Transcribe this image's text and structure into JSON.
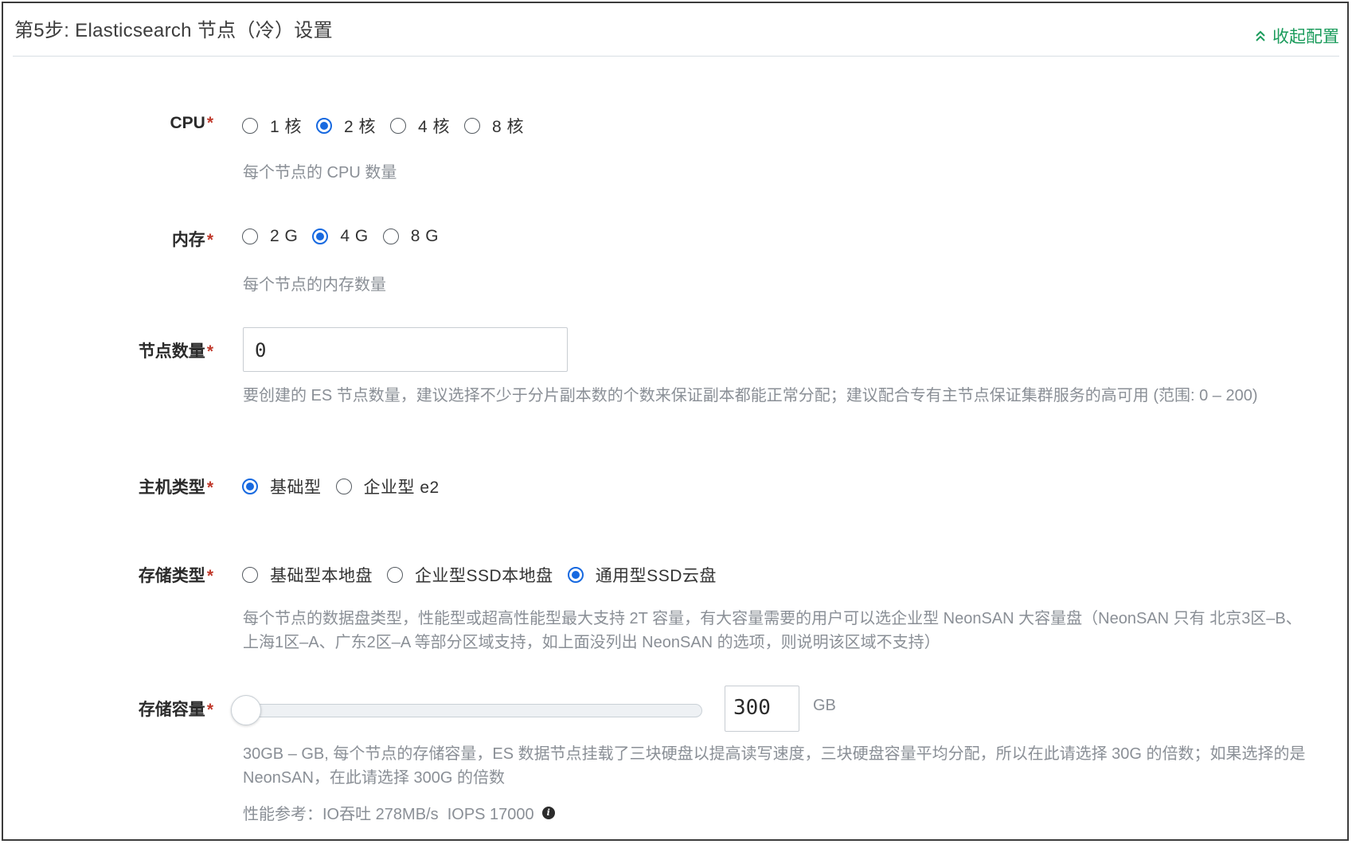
{
  "header": {
    "title": "第5步: Elasticsearch 节点（冷）设置",
    "collapse_label": "收起配置"
  },
  "cpu": {
    "label": "CPU",
    "required_mark": "*",
    "options": [
      {
        "label": "1 核",
        "selected": false
      },
      {
        "label": "2 核",
        "selected": true
      },
      {
        "label": "4 核",
        "selected": false
      },
      {
        "label": "8 核",
        "selected": false
      }
    ],
    "help": "每个节点的 CPU 数量"
  },
  "memory": {
    "label": "内存",
    "required_mark": "*",
    "options": [
      {
        "label": "2 G",
        "selected": false
      },
      {
        "label": "4 G",
        "selected": true
      },
      {
        "label": "8 G",
        "selected": false
      }
    ],
    "help": "每个节点的内存数量"
  },
  "node_count": {
    "label": "节点数量",
    "required_mark": "*",
    "value": "0",
    "help": "要创建的 ES 节点数量，建议选择不少于分片副本数的个数来保证副本都能正常分配；建议配合专有主节点保证集群服务的高可用 (范围: 0 – 200)"
  },
  "host_type": {
    "label": "主机类型",
    "required_mark": "*",
    "options": [
      {
        "label": "基础型",
        "selected": true
      },
      {
        "label": "企业型 e2",
        "selected": false
      }
    ]
  },
  "storage_type": {
    "label": "存储类型",
    "required_mark": "*",
    "options": [
      {
        "label": "基础型本地盘",
        "selected": false
      },
      {
        "label": "企业型SSD本地盘",
        "selected": false
      },
      {
        "label": "通用型SSD云盘",
        "selected": true
      }
    ],
    "help": "每个节点的数据盘类型，性能型或超高性能型最大支持 2T 容量，有大容量需要的用户可以选企业型 NeonSAN 大容量盘（NeonSAN 只有 北京3区–B、上海1区–A、广东2区–A 等部分区域支持，如上面没列出 NeonSAN 的选项，则说明该区域不支持）"
  },
  "storage_capacity": {
    "label": "存储容量",
    "required_mark": "*",
    "value": "300",
    "slider_fraction": 0,
    "unit": "GB",
    "help": "30GB – GB, 每个节点的存储容量，ES 数据节点挂载了三块硬盘以提高读写速度，三块硬盘容量平均分配，所以在此请选择 30G 的倍数；如果选择的是 NeonSAN，在此请选择 300G 的倍数",
    "perf": "性能参考：IO吞吐 278MB/s  IOPS 17000"
  },
  "colors": {
    "accent": "#1769e0",
    "collapse": "#1a9b5b",
    "required": "#c0392b",
    "help_text": "#8a8f96"
  }
}
